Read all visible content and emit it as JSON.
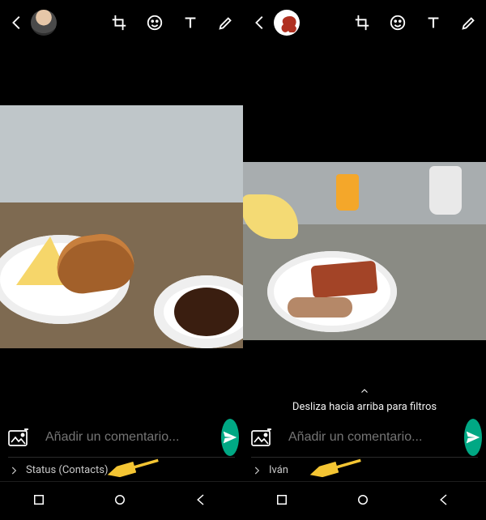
{
  "colors": {
    "send_button": "#00a884",
    "text_muted": "#8d8d8d"
  },
  "left": {
    "caption_placeholder": "Añadir un comentario...",
    "recipient_label": "Status (Contacts)"
  },
  "right": {
    "filter_hint": "Desliza hacia arriba para filtros",
    "caption_placeholder": "Añadir un comentario...",
    "recipient_label": "Iván"
  }
}
